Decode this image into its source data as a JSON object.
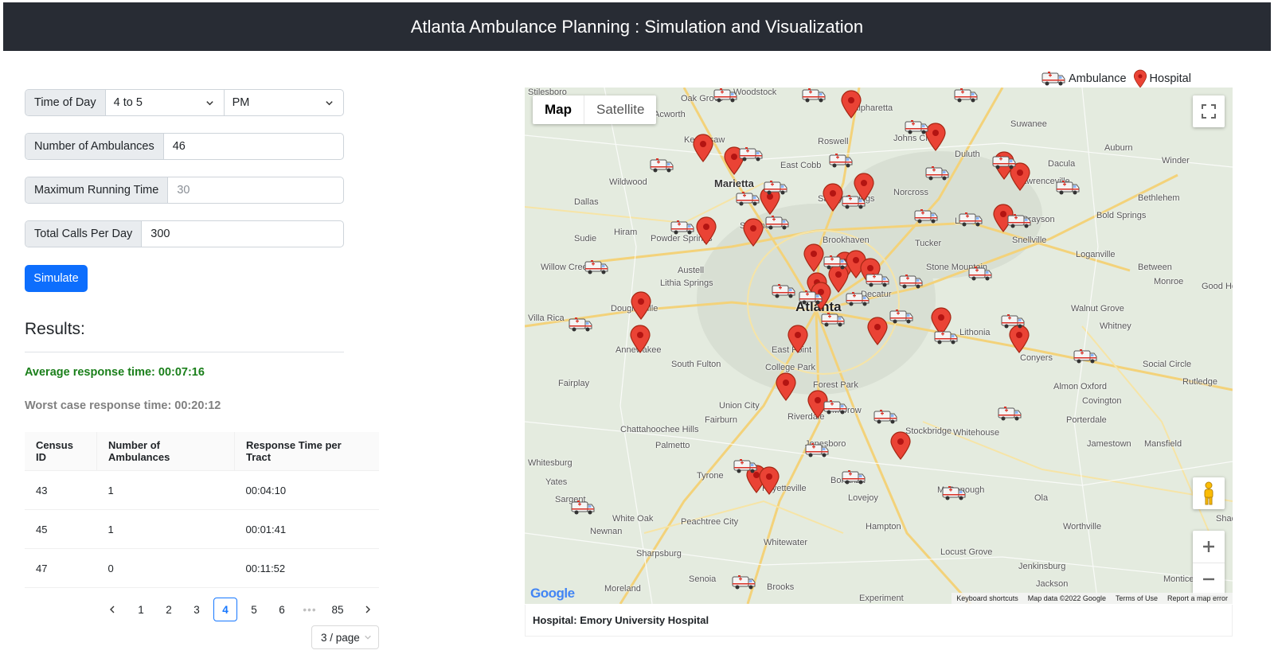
{
  "header": {
    "title": "Atlanta Ambulance Planning : Simulation and Visualization"
  },
  "controls": {
    "time_of_day": {
      "label": "Time of Day",
      "hour_range": "4 to 5",
      "period": "PM"
    },
    "num_ambulances": {
      "label": "Number of Ambulances",
      "value": "46"
    },
    "max_running_time": {
      "label": "Maximum Running Time",
      "placeholder": "30"
    },
    "total_calls": {
      "label": "Total Calls Per Day",
      "value": "300"
    },
    "simulate_label": "Simulate"
  },
  "results": {
    "heading": "Results:",
    "average": "Average response time: 00:07:16",
    "worst": "Worst case response time: 00:20:12"
  },
  "table": {
    "headers": [
      "Census ID",
      "Number of Ambulances",
      "Response Time per Tract"
    ],
    "rows": [
      [
        "43",
        "1",
        "00:04:10"
      ],
      [
        "45",
        "1",
        "00:01:41"
      ],
      [
        "47",
        "0",
        "00:11:52"
      ]
    ]
  },
  "pagination": {
    "pages": [
      "1",
      "2",
      "3",
      "4",
      "5",
      "6",
      "•••",
      "85"
    ],
    "current": "4",
    "page_size": "3 / page"
  },
  "legend": {
    "ambulance": "Ambulance",
    "hospital": "Hospital"
  },
  "map": {
    "type_map": "Map",
    "type_satellite": "Satellite",
    "logo": "Google",
    "attribution": [
      "Keyboard shortcuts",
      "Map data ©2022 Google",
      "Terms of Use",
      "Report a map error"
    ],
    "places": [
      {
        "name": "Stilesboro"
      },
      {
        "name": "Woodstock"
      },
      {
        "name": "Alpharetta"
      },
      {
        "name": "Oak Grove"
      },
      {
        "name": "Acworth"
      },
      {
        "name": "Suwanee"
      },
      {
        "name": "Kennesaw"
      },
      {
        "name": "Roswell"
      },
      {
        "name": "Johns Creek"
      },
      {
        "name": "Duluth"
      },
      {
        "name": "Dacula"
      },
      {
        "name": "Auburn"
      },
      {
        "name": "Winder"
      },
      {
        "name": "East Cobb"
      },
      {
        "name": "Wildwood"
      },
      {
        "name": "Marietta"
      },
      {
        "name": "Norcross"
      },
      {
        "name": "Lawrenceville"
      },
      {
        "name": "Dallas"
      },
      {
        "name": "Sandy Springs"
      },
      {
        "name": "Bethlehem"
      },
      {
        "name": "Hiram"
      },
      {
        "name": "Smyrna"
      },
      {
        "name": "Lilburn"
      },
      {
        "name": "Grayson"
      },
      {
        "name": "Bold Springs"
      },
      {
        "name": "Sudie"
      },
      {
        "name": "Powder Springs"
      },
      {
        "name": "Brookhaven"
      },
      {
        "name": "Tucker"
      },
      {
        "name": "Snellville"
      },
      {
        "name": "Willow Creek"
      },
      {
        "name": "Austell"
      },
      {
        "name": "Stone Mountain"
      },
      {
        "name": "Loganville"
      },
      {
        "name": "Between"
      },
      {
        "name": "Lithia Springs"
      },
      {
        "name": "Monroe"
      },
      {
        "name": "Good Hope"
      },
      {
        "name": "Decatur"
      },
      {
        "name": "Douglasville"
      },
      {
        "name": "Atlanta"
      },
      {
        "name": "Villa Rica"
      },
      {
        "name": "Walnut Grove"
      },
      {
        "name": "Lithonia"
      },
      {
        "name": "Whitney"
      },
      {
        "name": "Annewakee"
      },
      {
        "name": "East Point"
      },
      {
        "name": "Conyers"
      },
      {
        "name": "South Fulton"
      },
      {
        "name": "College Park"
      },
      {
        "name": "Social Circle"
      },
      {
        "name": "Fairplay"
      },
      {
        "name": "Forest Park"
      },
      {
        "name": "Almon"
      },
      {
        "name": "Oxford"
      },
      {
        "name": "Rutledge"
      },
      {
        "name": "Union City"
      },
      {
        "name": "Riverdale"
      },
      {
        "name": "Morrow"
      },
      {
        "name": "Covington"
      },
      {
        "name": "Porterdale"
      },
      {
        "name": "Fairburn"
      },
      {
        "name": "Chattahoochee Hills"
      },
      {
        "name": "Stockbridge"
      },
      {
        "name": "Whitehouse"
      },
      {
        "name": "Jonesboro"
      },
      {
        "name": "Palmetto"
      },
      {
        "name": "Jamestown"
      },
      {
        "name": "Mansfield"
      },
      {
        "name": "Whitesburg"
      },
      {
        "name": "Tyrone"
      },
      {
        "name": "Yates"
      },
      {
        "name": "Bonanza"
      },
      {
        "name": "Fayetteville"
      },
      {
        "name": "Sargent"
      },
      {
        "name": "McDonough"
      },
      {
        "name": "Ola"
      },
      {
        "name": "Lovejoy"
      },
      {
        "name": "White Oak"
      },
      {
        "name": "Newnan"
      },
      {
        "name": "Hampton"
      },
      {
        "name": "Worthville"
      },
      {
        "name": "Peachtree City"
      },
      {
        "name": "Shady Dale"
      },
      {
        "name": "Sharpsburg"
      },
      {
        "name": "Whitewater"
      },
      {
        "name": "Locust Grove"
      },
      {
        "name": "Jenkinsburg"
      },
      {
        "name": "Senoia"
      },
      {
        "name": "Jackson"
      },
      {
        "name": "Monticello"
      },
      {
        "name": "Moreland"
      },
      {
        "name": "Brooks"
      },
      {
        "name": "Experiment"
      }
    ]
  },
  "info": {
    "hospital": "Hospital: Emory University Hospital"
  }
}
